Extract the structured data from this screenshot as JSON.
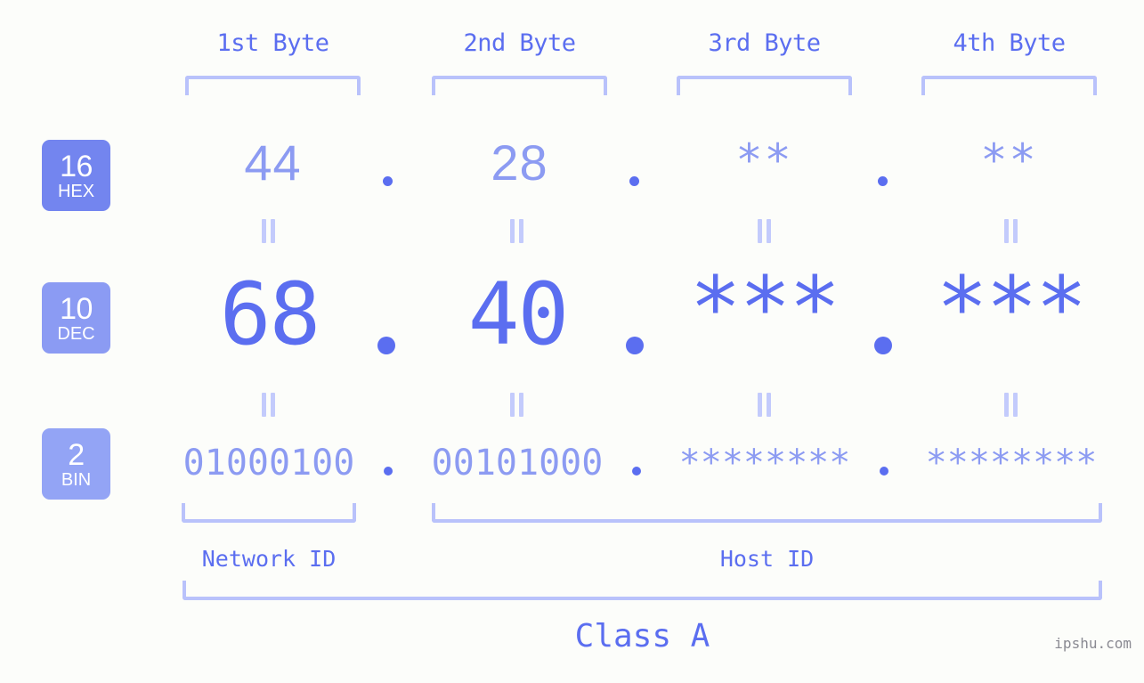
{
  "page": {
    "background_color": "#fcfdfa",
    "accent_strong": "#5b6ef0",
    "accent_mid": "#8c9bf2",
    "accent_light": "#b9c2fb",
    "watermark": "ipshu.com"
  },
  "byte_headers": [
    {
      "label": "1st Byte"
    },
    {
      "label": "2nd Byte"
    },
    {
      "label": "3rd Byte"
    },
    {
      "label": "4th Byte"
    }
  ],
  "bases": [
    {
      "number": "16",
      "name": "HEX",
      "color": "#7385ef"
    },
    {
      "number": "10",
      "name": "DEC",
      "color": "#8b9bf3"
    },
    {
      "number": "2",
      "name": "BIN",
      "color": "#93a4f5"
    }
  ],
  "rows": {
    "hex": {
      "base": "16",
      "values": [
        "44",
        "28",
        "**",
        "**"
      ]
    },
    "dec": {
      "base": "10",
      "values": [
        "68",
        "40",
        "***",
        "***"
      ]
    },
    "bin": {
      "base": "2",
      "values": [
        "01000100",
        "00101000",
        "********",
        "********"
      ]
    }
  },
  "separators": {
    "hex": [
      ".",
      ".",
      "."
    ],
    "dec": [
      ".",
      ".",
      "."
    ],
    "bin": [
      ".",
      ".",
      "."
    ]
  },
  "equals_mark": "=",
  "segments": [
    {
      "label": "Network ID"
    },
    {
      "label": "Host ID"
    }
  ],
  "class": {
    "label": "Class A"
  }
}
